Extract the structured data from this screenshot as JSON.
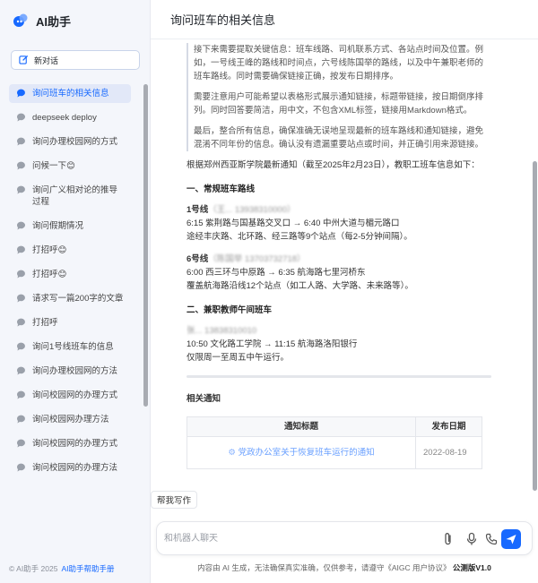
{
  "sidebar": {
    "brand_name": "AI助手",
    "new_chat_label": "新对话",
    "items": [
      {
        "label": "询问班车的相关信息",
        "active": true
      },
      {
        "label": "deepseek deploy"
      },
      {
        "label": "询问办理校园网的方式"
      },
      {
        "label": "问候一下😊"
      },
      {
        "label": "询问广义相对论的推导过程"
      },
      {
        "label": "询问假期情况"
      },
      {
        "label": "打招呼😊"
      },
      {
        "label": "打招呼😊"
      },
      {
        "label": "请求写一篇200字的文章"
      },
      {
        "label": "打招呼"
      },
      {
        "label": "询问1号线班车的信息"
      },
      {
        "label": "询问办理校园网的方法"
      },
      {
        "label": "询问校园网的办理方式"
      },
      {
        "label": "询问校园网办理方法"
      },
      {
        "label": "询问校园网的办理方式"
      },
      {
        "label": "询问校园网的办理方法"
      }
    ],
    "footer_copyright": "© AI助手 2025",
    "footer_link": "AI助手帮助手册"
  },
  "header": {
    "title": "询问班车的相关信息"
  },
  "message": {
    "think_paragraphs": [
      "接下来需要提取关键信息：班车线路、司机联系方式、各站点时间及位置。例如，一号线王峰的路线和时间点，六号线陈国举的路线，以及中午兼职老师的班车路线。同时需要确保链接正确，按发布日期排序。",
      "需要注意用户可能希望以表格形式展示通知链接，标题带链接，按日期倒序排列。同时回答要简洁，用中文，不包含XML标签，链接用Markdown格式。",
      "最后，整合所有信息，确保准确无误地呈现最新的班车路线和通知链接，避免混淆不同年份的信息。确认没有遗漏重要站点或时间，并正确引用来源链接。"
    ],
    "intro": "根据郑州西亚斯学院最新通知（截至2025年2月23日），教职工班车信息如下：",
    "section1_title": "一、常规班车路线",
    "route1": {
      "name": "1号线",
      "contact": "（王... 13938310000）",
      "line1": "6:15 紫荆路与国基路交叉口 → 6:40 中州大道与楣元路口",
      "line2": "途经丰庆路、北环路、经三路等9个站点（每2-5分钟间隔）。"
    },
    "route6": {
      "name": "6号线",
      "contact": "（陈国举 13703732718）",
      "line1": "6:00 西三环与中原路 → 6:35 航海路七里河桥东",
      "line2": "覆盖航海路沿线12个站点（如工人路、大学路、未来路等）。"
    },
    "section2_title": "二、兼职教师午间班车",
    "noon": {
      "contact": "张... 13838310010",
      "line1": "10:50 文化路工学院 → 11:15 航海路洛阳银行",
      "line2": "仅限周一至周五中午运行。"
    },
    "notice_title": "相关通知",
    "table": {
      "headers": [
        "通知标题",
        "发布日期"
      ],
      "rows": [
        {
          "title": "党政办公室关于恢复班车运行的通知",
          "date": "2022-08-19"
        }
      ]
    }
  },
  "composer": {
    "helper_tag": "帮我写作",
    "placeholder": "和机器人聊天"
  },
  "footer": {
    "disclaimer": "内容由 AI 生成，无法确保真实准确，仅供参考，请遵守《AIGC 用户协议》",
    "version": "公测版V1.0"
  },
  "colors": {
    "accent": "#1769ff",
    "sidebar_bg": "#f4f6fb"
  }
}
